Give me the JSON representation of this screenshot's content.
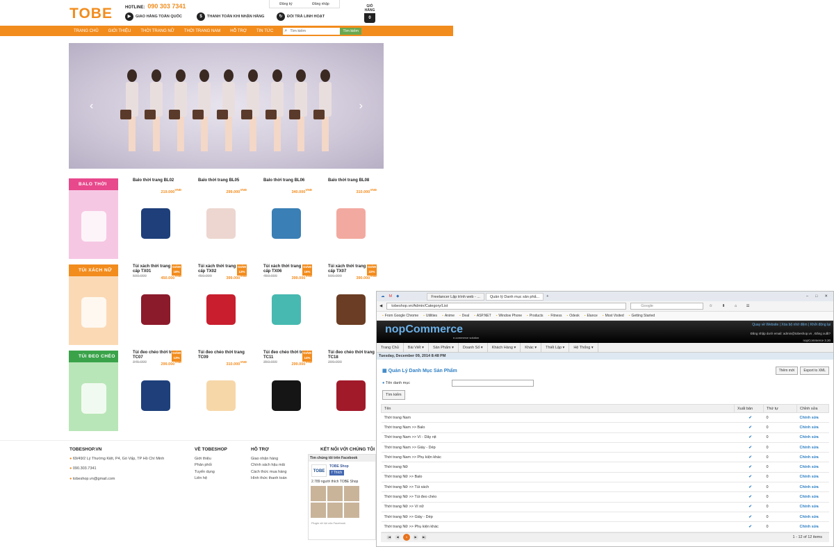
{
  "shop": {
    "logo": {
      "main": "TOBE"
    },
    "hotline": {
      "label": "HOTLINE:",
      "number": "090 303 7341"
    },
    "auth": {
      "register": "Đăng ký",
      "login": "Đăng nhập"
    },
    "services": [
      "GIAO HÀNG TOÀN QUỐC",
      "THANH TOÁN KHI NHẬN HÀNG",
      "ĐỔI TRẢ LINH HOẠT"
    ],
    "cart": {
      "label": "GIỎ HÀNG",
      "count": "0"
    },
    "nav": [
      "TRANG CHỦ",
      "GIỚI THIỆU",
      "THỜI TRANG NỮ",
      "THỜI TRANG NAM",
      "HỖ TRỢ",
      "TIN TỨC"
    ],
    "search": {
      "placeholder": "Tìm kiếm",
      "button": "Tìm kiếm"
    },
    "categories": [
      {
        "title": "BALO THỜI TRANG",
        "color": "#e8488c",
        "bg": "#f6c7e3"
      },
      {
        "title": "TÚI XÁCH NỮ",
        "color": "#f28c1d",
        "bg": "#fbd9b5"
      },
      {
        "title": "TÚI ĐEO CHÉO",
        "color": "#3aa34a",
        "bg": "#b9e6b8"
      }
    ],
    "products": [
      [
        {
          "name": "Balo thời trang BL02",
          "old": "",
          "price": "219.000",
          "disc": "",
          "color": "#1e3f7a"
        },
        {
          "name": "Balo thời trang BL05",
          "old": "",
          "price": "299.000",
          "disc": "",
          "color": "#ecd6cf"
        },
        {
          "name": "Balo thời trang BL06",
          "old": "",
          "price": "340.000",
          "disc": "",
          "color": "#3a7fb5"
        },
        {
          "name": "Balo thời trang BL08",
          "old": "",
          "price": "310.000",
          "disc": "",
          "color": "#f2a9a0"
        }
      ],
      [
        {
          "name": "Túi xách thời trang cao cấp TX01",
          "old": "500.000",
          "price": "450.000",
          "disc": "18%",
          "color": "#8b1a2b"
        },
        {
          "name": "Túi xách thời trang cao cấp TX02",
          "old": "450.000",
          "price": "399.000",
          "disc": "13%",
          "color": "#c81e2e"
        },
        {
          "name": "Túi xách thời trang cao cấp TX06",
          "old": "450.000",
          "price": "399.000",
          "disc": "16%",
          "color": "#47b9b0"
        },
        {
          "name": "Túi xách thời trang cao cấp TX07",
          "old": "500.000",
          "price": "390.000",
          "disc": "22%",
          "color": "#6b3d24"
        }
      ],
      [
        {
          "name": "Túi đeo chéo thời trang TC07",
          "old": "345.000",
          "price": "299.000",
          "disc": "13%",
          "color": "#1e3f7a"
        },
        {
          "name": "Túi đeo chéo thời trang TC09",
          "old": "",
          "price": "310.000",
          "disc": "",
          "color": "#f6d7a8"
        },
        {
          "name": "Túi đeo chéo thời trang TC11",
          "old": "350.000",
          "price": "299.000",
          "disc": "14%",
          "color": "#151515"
        },
        {
          "name": "Túi đeo chéo thời trang TC18",
          "old": "299.000",
          "price": "",
          "disc": "",
          "color": "#a11a2a"
        }
      ]
    ],
    "currency": "VNĐ",
    "footer": {
      "col1": {
        "title": "TOBESHOP.VN",
        "address": "69/49/2 Lý Thường Kiệt, P4, Gò Vấp, TP Hồ Chí Minh",
        "phone": "090.303.7341",
        "email": "tobeshop.vn@gmail.com"
      },
      "col2": {
        "title": "VỀ TOBESHOP",
        "items": [
          "Giới thiệu",
          "Phản phối",
          "Tuyển dụng",
          "Liên hệ"
        ]
      },
      "col3": {
        "title": "HỖ TRỢ",
        "items": [
          "Giao nhận hàng",
          "Chính sách hậu mãi",
          "Cách thức mua hàng",
          "Hình thức thanh toán"
        ]
      },
      "col4": {
        "title": "KẾT NỐI VỚI CHÚNG TÔI"
      },
      "fb": {
        "header": "Tìm chúng tôi trên Facebook",
        "page": "TOBE Shop",
        "like": "Thích",
        "count": "2.789 người thích TOBE Shop",
        "plugin": "Plugin xã hội của Facebook"
      }
    }
  },
  "browser": {
    "tabs": [
      "Freelancer Lập trình web - ...",
      "Quản lý Danh mục sản phẩ..."
    ],
    "url": "tobeshop.vn/Admin/Category/List",
    "search": "Google",
    "bookmarks": [
      "From Google Chrome",
      "Utilities",
      "Anime",
      "Deal",
      "ASP.NET",
      "Window Phone",
      "Products",
      "Fitness",
      "Odesk",
      "Elance",
      "Most Visited",
      "Getting Started"
    ]
  },
  "admin": {
    "logo": "nopCommerce",
    "logo_sub": "e-commerce solution",
    "links": "Quay về Website  |  Xóa bộ nhớ đệm  |  Khởi động lại",
    "email": "Đăng nhập dưới email: admin@tobeshop.vn , Đăng xuất?",
    "version": "nopCommerce 3.30",
    "menu": [
      "Trang Chủ",
      "Bài Viết ▾",
      "Sản Phẩm ▾",
      "Doanh Số ▾",
      "Khách Hàng ▾",
      "Khác ▾",
      "Thiết Lập ▾",
      "Hệ Thống ▾"
    ],
    "date": "Tuesday, December 09, 2014 8:48 PM",
    "title": "Quản Lý Danh Mục Sản Phẩm",
    "btn_new": "Thêm mới",
    "btn_export": "Export to XML",
    "filter_label": "Tên danh mục",
    "search_btn": "Tìm kiếm",
    "headers": [
      "Tên",
      "Xuất bản",
      "Thứ tự",
      "Chỉnh sửa"
    ],
    "rows": [
      {
        "name": "Thời trang Nam",
        "order": "0"
      },
      {
        "name": "Thời trang Nam >> Balo",
        "order": "0"
      },
      {
        "name": "Thời trang Nam >> Ví - Dây nịt",
        "order": "0"
      },
      {
        "name": "Thời trang Nam >> Giày - Dép",
        "order": "0"
      },
      {
        "name": "Thời trang Nam >> Phụ kiện khác",
        "order": "0"
      },
      {
        "name": "Thời trang Nữ",
        "order": "0"
      },
      {
        "name": "Thời trang Nữ >> Balo",
        "order": "0"
      },
      {
        "name": "Thời trang Nữ >> Túi xách",
        "order": "0"
      },
      {
        "name": "Thời trang Nữ >> Túi đeo chéo",
        "order": "0"
      },
      {
        "name": "Thời trang Nữ >> Ví nữ",
        "order": "0"
      },
      {
        "name": "Thời trang Nữ >> Giày - Dép",
        "order": "0"
      },
      {
        "name": "Thời trang Nữ >> Phụ kiện khác",
        "order": "0"
      }
    ],
    "edit_label": "Chỉnh sửa",
    "page": "1",
    "count": "1 - 12 of 12 items"
  }
}
